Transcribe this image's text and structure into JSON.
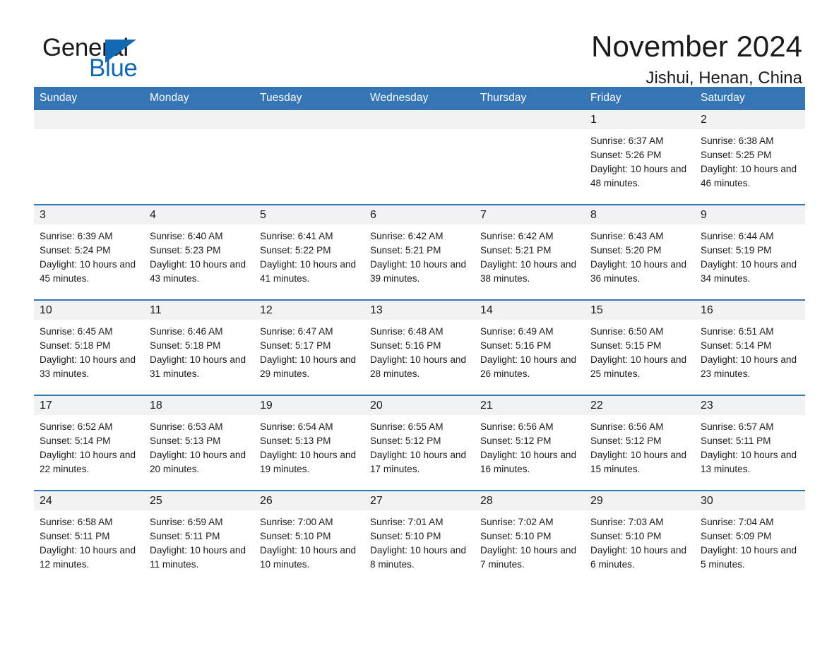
{
  "logo": {
    "word_one": "General",
    "word_two": "Blue",
    "triangle_icon": "triangle-icon",
    "accent_color": "#1268b3"
  },
  "header": {
    "month_title": "November 2024",
    "location": "Jishui, Henan, China"
  },
  "calendar": {
    "header_bg_color": "#3575b5",
    "daynum_band_color": "#f2f2f2",
    "weekday_headers": [
      "Sunday",
      "Monday",
      "Tuesday",
      "Wednesday",
      "Thursday",
      "Friday",
      "Saturday"
    ],
    "weeks": [
      [
        {
          "day": "",
          "empty": true
        },
        {
          "day": "",
          "empty": true
        },
        {
          "day": "",
          "empty": true
        },
        {
          "day": "",
          "empty": true
        },
        {
          "day": "",
          "empty": true
        },
        {
          "day": "1",
          "sunrise": "Sunrise: 6:37 AM",
          "sunset": "Sunset: 5:26 PM",
          "daylight": "Daylight: 10 hours and 48 minutes."
        },
        {
          "day": "2",
          "sunrise": "Sunrise: 6:38 AM",
          "sunset": "Sunset: 5:25 PM",
          "daylight": "Daylight: 10 hours and 46 minutes."
        }
      ],
      [
        {
          "day": "3",
          "sunrise": "Sunrise: 6:39 AM",
          "sunset": "Sunset: 5:24 PM",
          "daylight": "Daylight: 10 hours and 45 minutes."
        },
        {
          "day": "4",
          "sunrise": "Sunrise: 6:40 AM",
          "sunset": "Sunset: 5:23 PM",
          "daylight": "Daylight: 10 hours and 43 minutes."
        },
        {
          "day": "5",
          "sunrise": "Sunrise: 6:41 AM",
          "sunset": "Sunset: 5:22 PM",
          "daylight": "Daylight: 10 hours and 41 minutes."
        },
        {
          "day": "6",
          "sunrise": "Sunrise: 6:42 AM",
          "sunset": "Sunset: 5:21 PM",
          "daylight": "Daylight: 10 hours and 39 minutes."
        },
        {
          "day": "7",
          "sunrise": "Sunrise: 6:42 AM",
          "sunset": "Sunset: 5:21 PM",
          "daylight": "Daylight: 10 hours and 38 minutes."
        },
        {
          "day": "8",
          "sunrise": "Sunrise: 6:43 AM",
          "sunset": "Sunset: 5:20 PM",
          "daylight": "Daylight: 10 hours and 36 minutes."
        },
        {
          "day": "9",
          "sunrise": "Sunrise: 6:44 AM",
          "sunset": "Sunset: 5:19 PM",
          "daylight": "Daylight: 10 hours and 34 minutes."
        }
      ],
      [
        {
          "day": "10",
          "sunrise": "Sunrise: 6:45 AM",
          "sunset": "Sunset: 5:18 PM",
          "daylight": "Daylight: 10 hours and 33 minutes."
        },
        {
          "day": "11",
          "sunrise": "Sunrise: 6:46 AM",
          "sunset": "Sunset: 5:18 PM",
          "daylight": "Daylight: 10 hours and 31 minutes."
        },
        {
          "day": "12",
          "sunrise": "Sunrise: 6:47 AM",
          "sunset": "Sunset: 5:17 PM",
          "daylight": "Daylight: 10 hours and 29 minutes."
        },
        {
          "day": "13",
          "sunrise": "Sunrise: 6:48 AM",
          "sunset": "Sunset: 5:16 PM",
          "daylight": "Daylight: 10 hours and 28 minutes."
        },
        {
          "day": "14",
          "sunrise": "Sunrise: 6:49 AM",
          "sunset": "Sunset: 5:16 PM",
          "daylight": "Daylight: 10 hours and 26 minutes."
        },
        {
          "day": "15",
          "sunrise": "Sunrise: 6:50 AM",
          "sunset": "Sunset: 5:15 PM",
          "daylight": "Daylight: 10 hours and 25 minutes."
        },
        {
          "day": "16",
          "sunrise": "Sunrise: 6:51 AM",
          "sunset": "Sunset: 5:14 PM",
          "daylight": "Daylight: 10 hours and 23 minutes."
        }
      ],
      [
        {
          "day": "17",
          "sunrise": "Sunrise: 6:52 AM",
          "sunset": "Sunset: 5:14 PM",
          "daylight": "Daylight: 10 hours and 22 minutes."
        },
        {
          "day": "18",
          "sunrise": "Sunrise: 6:53 AM",
          "sunset": "Sunset: 5:13 PM",
          "daylight": "Daylight: 10 hours and 20 minutes."
        },
        {
          "day": "19",
          "sunrise": "Sunrise: 6:54 AM",
          "sunset": "Sunset: 5:13 PM",
          "daylight": "Daylight: 10 hours and 19 minutes."
        },
        {
          "day": "20",
          "sunrise": "Sunrise: 6:55 AM",
          "sunset": "Sunset: 5:12 PM",
          "daylight": "Daylight: 10 hours and 17 minutes."
        },
        {
          "day": "21",
          "sunrise": "Sunrise: 6:56 AM",
          "sunset": "Sunset: 5:12 PM",
          "daylight": "Daylight: 10 hours and 16 minutes."
        },
        {
          "day": "22",
          "sunrise": "Sunrise: 6:56 AM",
          "sunset": "Sunset: 5:12 PM",
          "daylight": "Daylight: 10 hours and 15 minutes."
        },
        {
          "day": "23",
          "sunrise": "Sunrise: 6:57 AM",
          "sunset": "Sunset: 5:11 PM",
          "daylight": "Daylight: 10 hours and 13 minutes."
        }
      ],
      [
        {
          "day": "24",
          "sunrise": "Sunrise: 6:58 AM",
          "sunset": "Sunset: 5:11 PM",
          "daylight": "Daylight: 10 hours and 12 minutes."
        },
        {
          "day": "25",
          "sunrise": "Sunrise: 6:59 AM",
          "sunset": "Sunset: 5:11 PM",
          "daylight": "Daylight: 10 hours and 11 minutes."
        },
        {
          "day": "26",
          "sunrise": "Sunrise: 7:00 AM",
          "sunset": "Sunset: 5:10 PM",
          "daylight": "Daylight: 10 hours and 10 minutes."
        },
        {
          "day": "27",
          "sunrise": "Sunrise: 7:01 AM",
          "sunset": "Sunset: 5:10 PM",
          "daylight": "Daylight: 10 hours and 8 minutes."
        },
        {
          "day": "28",
          "sunrise": "Sunrise: 7:02 AM",
          "sunset": "Sunset: 5:10 PM",
          "daylight": "Daylight: 10 hours and 7 minutes."
        },
        {
          "day": "29",
          "sunrise": "Sunrise: 7:03 AM",
          "sunset": "Sunset: 5:10 PM",
          "daylight": "Daylight: 10 hours and 6 minutes."
        },
        {
          "day": "30",
          "sunrise": "Sunrise: 7:04 AM",
          "sunset": "Sunset: 5:09 PM",
          "daylight": "Daylight: 10 hours and 5 minutes."
        }
      ]
    ]
  }
}
